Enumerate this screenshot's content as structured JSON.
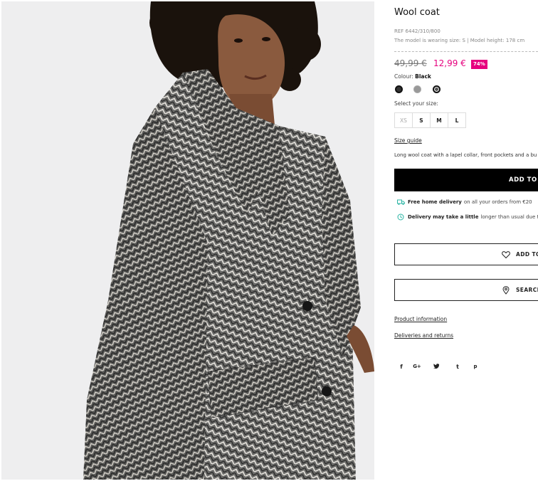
{
  "product": {
    "title": "Wool coat",
    "ref": "REF 6442/310/800",
    "model_info": "The model is wearing size: S | Model height: 178 cm",
    "old_price": "49,99 €",
    "new_price": "12,99 €",
    "discount": "74%",
    "colour_label": "Colour: ",
    "colour_value": "Black",
    "select_size_label": "Select your size:",
    "sizes": [
      "XS",
      "S",
      "M",
      "L"
    ],
    "size_guide": "Size guide",
    "description": "Long wool coat with a lapel collar, front pockets and a bu",
    "add_to_bag": "ADD TO B"
  },
  "delivery": {
    "free_bold": "Free home delivery",
    "free_rest": "on all your orders from €20",
    "delay_bold": "Delivery may take a little",
    "delay_rest": "longer than usual due t"
  },
  "actions": {
    "wishlist": "ADD TO",
    "search_store": "SEARCH"
  },
  "links": {
    "product_information": "Product information",
    "deliveries_returns": "Deliveries and returns"
  },
  "social": [
    "f",
    "G+",
    "t-bird",
    "t",
    "p"
  ],
  "colors": {
    "accent": "#e6007e",
    "button": "#000000",
    "delivery_icon": "#2bb5a4"
  }
}
